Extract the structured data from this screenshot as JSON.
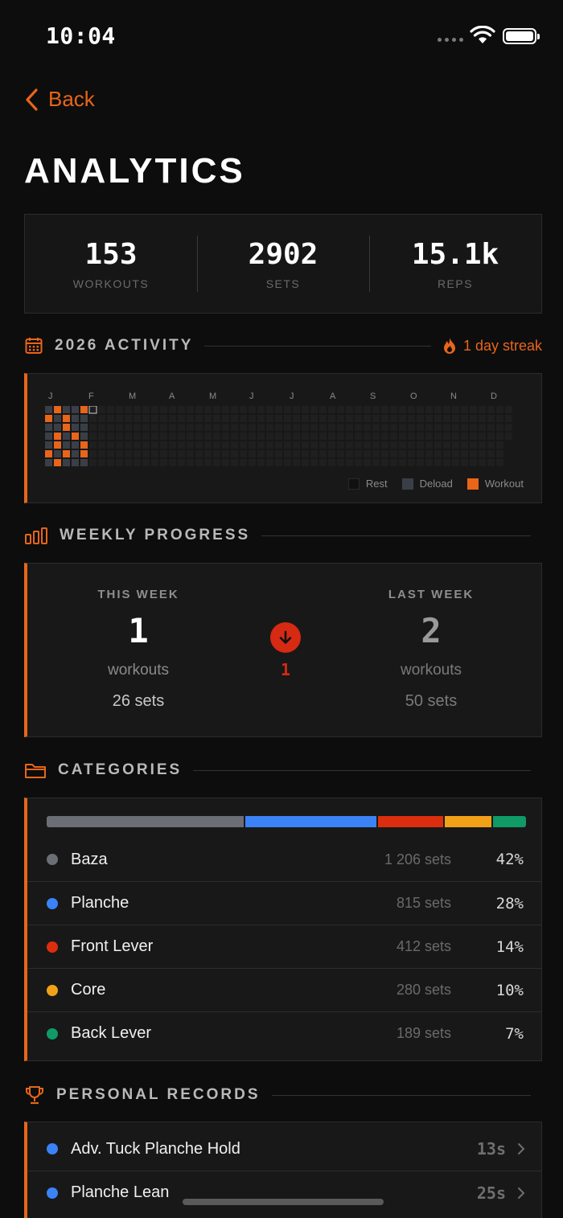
{
  "status_bar": {
    "time": "10:04"
  },
  "nav": {
    "back_label": "Back"
  },
  "page": {
    "title": "ANALYTICS"
  },
  "summary": [
    {
      "value": "153",
      "label": "WORKOUTS"
    },
    {
      "value": "2902",
      "label": "SETS"
    },
    {
      "value": "15.1k",
      "label": "REPS"
    }
  ],
  "activity": {
    "title": "2026 ACTIVITY",
    "streak": "1 day streak",
    "months": [
      "J",
      "F",
      "M",
      "A",
      "M",
      "J",
      "J",
      "A",
      "S",
      "O",
      "N",
      "D"
    ],
    "legend": {
      "rest": "Rest",
      "deload": "Deload",
      "workout": "Workout"
    },
    "colors": {
      "rest": "#111111",
      "deload": "#3a3f47",
      "workout": "#e8651a",
      "empty": "#1f1f1f"
    },
    "weeks_shown": 53,
    "recorded_weeks": [
      [
        "deload",
        "workout",
        "deload",
        "deload",
        "deload",
        "workout",
        "deload"
      ],
      [
        "workout",
        "deload",
        "deload",
        "workout",
        "workout",
        "deload",
        "workout"
      ],
      [
        "deload",
        "workout",
        "workout",
        "deload",
        "deload",
        "workout",
        "deload"
      ],
      [
        "deload",
        "deload",
        "deload",
        "workout",
        "deload",
        "deload",
        "deload"
      ],
      [
        "workout",
        "deload",
        "deload",
        "deload",
        "workout",
        "workout",
        "deload"
      ],
      [
        "today"
      ]
    ]
  },
  "weekly": {
    "title": "WEEKLY PROGRESS",
    "this_week": {
      "label": "THIS WEEK",
      "workouts": "1",
      "unit": "workouts",
      "sets": "26 sets"
    },
    "last_week": {
      "label": "LAST WEEK",
      "workouts": "2",
      "unit": "workouts",
      "sets": "50 sets"
    },
    "diff": "1",
    "trend": "down"
  },
  "categories": {
    "title": "CATEGORIES",
    "items": [
      {
        "name": "Baza",
        "sets": "1 206 sets",
        "pct": "42%",
        "share": 42,
        "color": "#6b6e75"
      },
      {
        "name": "Planche",
        "sets": "815 sets",
        "pct": "28%",
        "share": 28,
        "color": "#3b82f6"
      },
      {
        "name": "Front Lever",
        "sets": "412 sets",
        "pct": "14%",
        "share": 14,
        "color": "#dc2e0e"
      },
      {
        "name": "Core",
        "sets": "280 sets",
        "pct": "10%",
        "share": 10,
        "color": "#f0a118"
      },
      {
        "name": "Back Lever",
        "sets": "189 sets",
        "pct": "7%",
        "share": 7,
        "color": "#0f9a66"
      }
    ]
  },
  "records": {
    "title": "PERSONAL RECORDS",
    "items": [
      {
        "name": "Adv. Tuck Planche Hold",
        "value": "13s",
        "color": "#3b82f6"
      },
      {
        "name": "Planche Lean",
        "value": "25s",
        "color": "#3b82f6"
      }
    ]
  }
}
